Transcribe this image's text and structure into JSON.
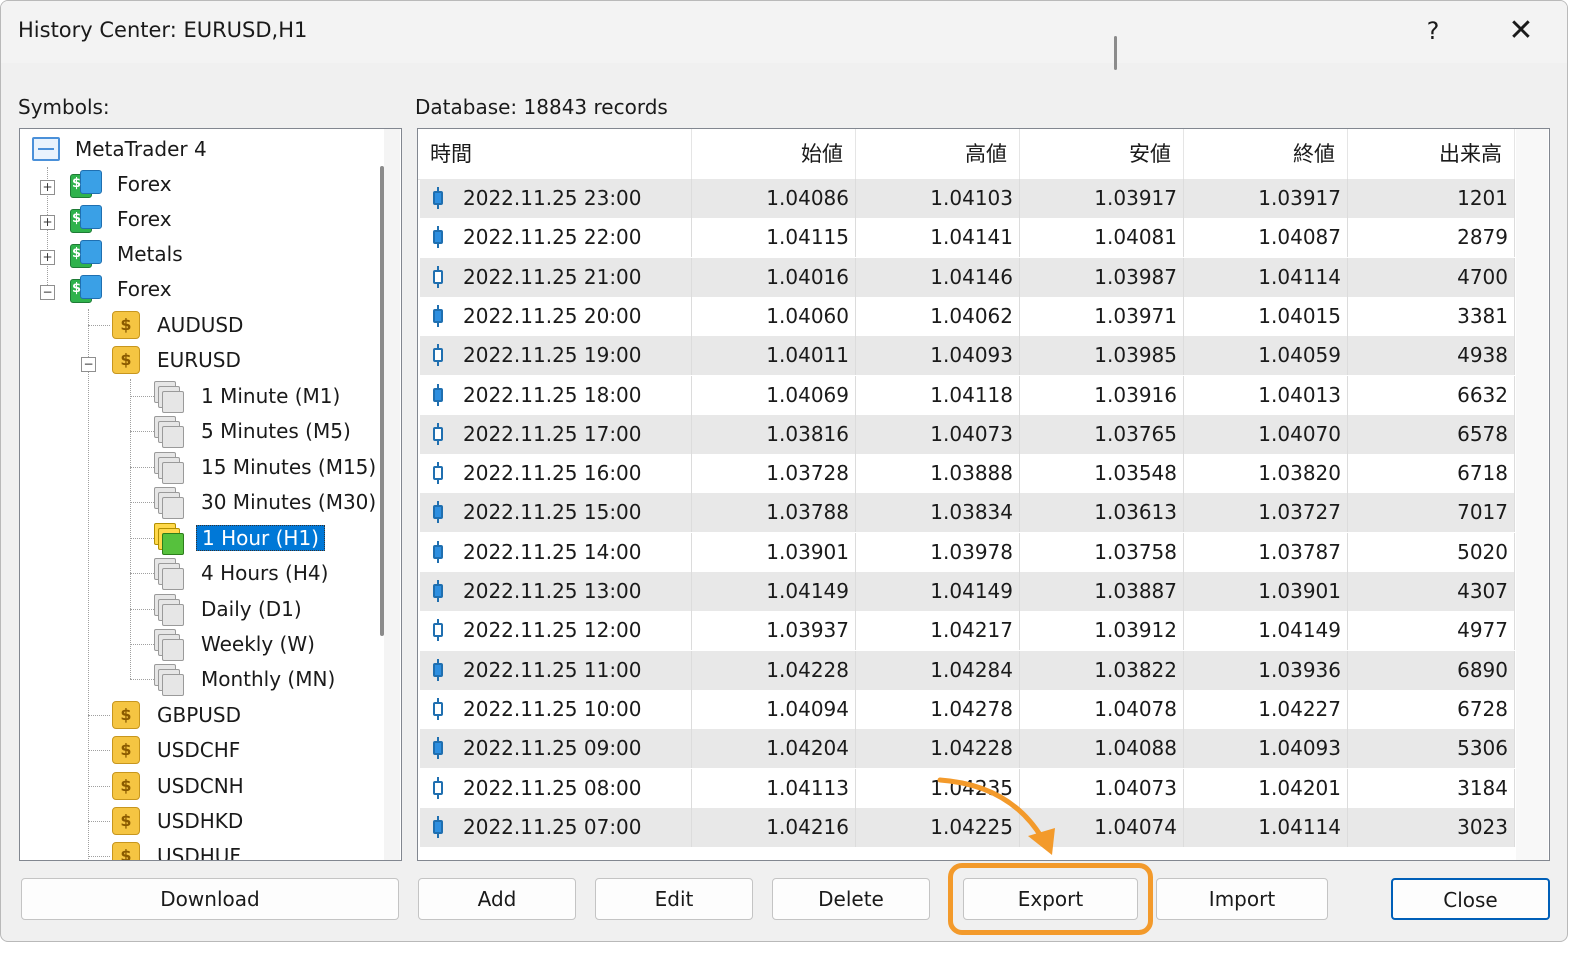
{
  "window": {
    "title": "History Center: EURUSD,H1",
    "help_label": "?",
    "close_label": "✕"
  },
  "labels": {
    "symbols": "Symbols:",
    "database": "Database:  18843 records"
  },
  "tree": {
    "root": "MetaTrader 4",
    "groups": [
      "Forex",
      "Forex",
      "Metals",
      "Forex"
    ],
    "symbols_before": [
      "AUDUSD",
      "EURUSD"
    ],
    "timeframes": [
      "1 Minute (M1)",
      "5 Minutes (M5)",
      "15 Minutes (M15)",
      "30 Minutes (M30)",
      "1 Hour (H1)",
      "4 Hours (H4)",
      "Daily (D1)",
      "Weekly (W)",
      "Monthly (MN)"
    ],
    "selected_timeframe": "1 Hour (H1)",
    "symbols_after": [
      "GBPUSD",
      "USDCHF",
      "USDCNH",
      "USDHKD",
      "USDHUF"
    ]
  },
  "table": {
    "columns": [
      "時間",
      "始値",
      "高値",
      "安値",
      "終値",
      "出来高"
    ],
    "rows": [
      {
        "time": "2022.11.25 23:00",
        "open": "1.04086",
        "high": "1.04103",
        "low": "1.03917",
        "close": "1.03917",
        "volume": "1201",
        "candle": "bear"
      },
      {
        "time": "2022.11.25 22:00",
        "open": "1.04115",
        "high": "1.04141",
        "low": "1.04081",
        "close": "1.04087",
        "volume": "2879",
        "candle": "bear"
      },
      {
        "time": "2022.11.25 21:00",
        "open": "1.04016",
        "high": "1.04146",
        "low": "1.03987",
        "close": "1.04114",
        "volume": "4700",
        "candle": "bull"
      },
      {
        "time": "2022.11.25 20:00",
        "open": "1.04060",
        "high": "1.04062",
        "low": "1.03971",
        "close": "1.04015",
        "volume": "3381",
        "candle": "bear"
      },
      {
        "time": "2022.11.25 19:00",
        "open": "1.04011",
        "high": "1.04093",
        "low": "1.03985",
        "close": "1.04059",
        "volume": "4938",
        "candle": "bull"
      },
      {
        "time": "2022.11.25 18:00",
        "open": "1.04069",
        "high": "1.04118",
        "low": "1.03916",
        "close": "1.04013",
        "volume": "6632",
        "candle": "bear"
      },
      {
        "time": "2022.11.25 17:00",
        "open": "1.03816",
        "high": "1.04073",
        "low": "1.03765",
        "close": "1.04070",
        "volume": "6578",
        "candle": "bull"
      },
      {
        "time": "2022.11.25 16:00",
        "open": "1.03728",
        "high": "1.03888",
        "low": "1.03548",
        "close": "1.03820",
        "volume": "6718",
        "candle": "bull"
      },
      {
        "time": "2022.11.25 15:00",
        "open": "1.03788",
        "high": "1.03834",
        "low": "1.03613",
        "close": "1.03727",
        "volume": "7017",
        "candle": "bear"
      },
      {
        "time": "2022.11.25 14:00",
        "open": "1.03901",
        "high": "1.03978",
        "low": "1.03758",
        "close": "1.03787",
        "volume": "5020",
        "candle": "bear"
      },
      {
        "time": "2022.11.25 13:00",
        "open": "1.04149",
        "high": "1.04149",
        "low": "1.03887",
        "close": "1.03901",
        "volume": "4307",
        "candle": "bear"
      },
      {
        "time": "2022.11.25 12:00",
        "open": "1.03937",
        "high": "1.04217",
        "low": "1.03912",
        "close": "1.04149",
        "volume": "4977",
        "candle": "bull"
      },
      {
        "time": "2022.11.25 11:00",
        "open": "1.04228",
        "high": "1.04284",
        "low": "1.03822",
        "close": "1.03936",
        "volume": "6890",
        "candle": "bear"
      },
      {
        "time": "2022.11.25 10:00",
        "open": "1.04094",
        "high": "1.04278",
        "low": "1.04078",
        "close": "1.04227",
        "volume": "6728",
        "candle": "bull"
      },
      {
        "time": "2022.11.25 09:00",
        "open": "1.04204",
        "high": "1.04228",
        "low": "1.04088",
        "close": "1.04093",
        "volume": "5306",
        "candle": "bear"
      },
      {
        "time": "2022.11.25 08:00",
        "open": "1.04113",
        "high": "1.04235",
        "low": "1.04073",
        "close": "1.04201",
        "volume": "3184",
        "candle": "bull"
      },
      {
        "time": "2022.11.25 07:00",
        "open": "1.04216",
        "high": "1.04225",
        "low": "1.04074",
        "close": "1.04114",
        "volume": "3023",
        "candle": "bear"
      }
    ]
  },
  "buttons": {
    "download": "Download",
    "add": "Add",
    "edit": "Edit",
    "delete": "Delete",
    "export": "Export",
    "import": "Import",
    "close": "Close"
  },
  "colors": {
    "highlight": "#f39a2b",
    "selection": "#0078d7",
    "candle": "#1f6fb0"
  }
}
